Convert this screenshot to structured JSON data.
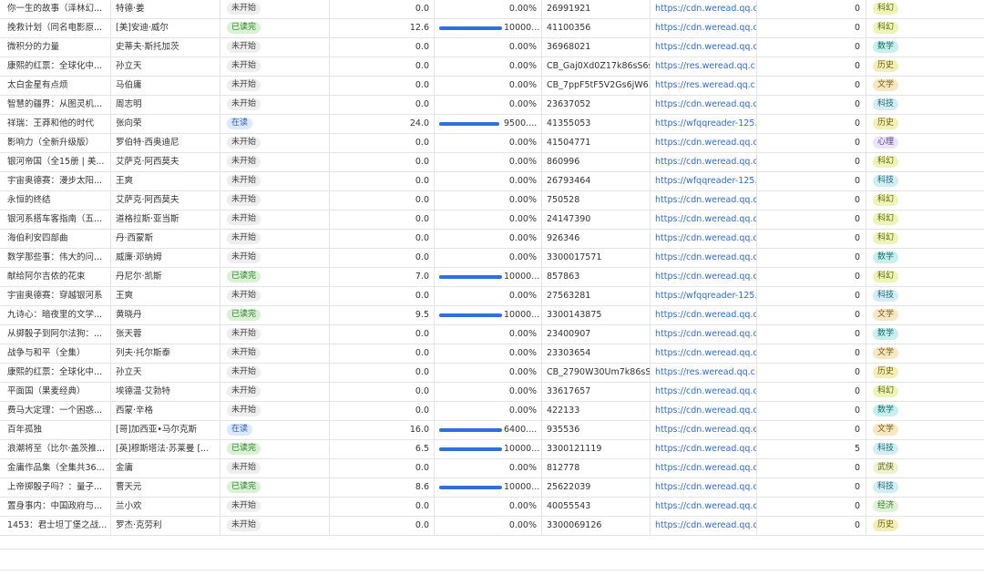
{
  "table": {
    "rows": [
      {
        "title": "你一生的故事（泽林幻...",
        "author": "特德·姜",
        "status": "未开始",
        "hours": "0.0",
        "progress": 0,
        "progress_text": "0.00%",
        "book_id": "26991921",
        "url": "https://cdn.weread.qq.c...",
        "notes": "0",
        "category": "科幻"
      },
      {
        "title": "挽救计划（同名电影原...",
        "author": "[美]安迪·威尔",
        "status": "已读完",
        "hours": "12.6",
        "progress": 1,
        "progress_text": "10000...",
        "book_id": "41100356",
        "url": "https://cdn.weread.qq.c...",
        "notes": "0",
        "category": "科幻"
      },
      {
        "title": "微积分的力量",
        "author": "史蒂夫·斯托加茨",
        "status": "未开始",
        "hours": "0.0",
        "progress": 0,
        "progress_text": "0.00%",
        "book_id": "36968021",
        "url": "https://cdn.weread.qq.c...",
        "notes": "0",
        "category": "数学"
      },
      {
        "title": "康熙的红票：全球化中...",
        "author": "孙立天",
        "status": "未开始",
        "hours": "0.0",
        "progress": 0,
        "progress_text": "0.00%",
        "book_id": "CB_Gaj0Xd0Z17k86sS6s...",
        "url": "https://res.weread.qq.c...",
        "notes": "0",
        "category": "历史"
      },
      {
        "title": "太白金星有点烦",
        "author": "马伯庸",
        "status": "未开始",
        "hours": "0.0",
        "progress": 0,
        "progress_text": "0.00%",
        "book_id": "CB_7ppF5tF5V2Gs6jW6...",
        "url": "https://res.weread.qq.c...",
        "notes": "0",
        "category": "文学"
      },
      {
        "title": "智慧的疆界：从图灵机...",
        "author": "周志明",
        "status": "未开始",
        "hours": "0.0",
        "progress": 0,
        "progress_text": "0.00%",
        "book_id": "23637052",
        "url": "https://cdn.weread.qq.c...",
        "notes": "0",
        "category": "科技"
      },
      {
        "title": "祥瑞：王莽和他的时代",
        "author": "张向荣",
        "status": "在读",
        "hours": "24.0",
        "progress": 0.95,
        "progress_text": "9500....",
        "book_id": "41355053",
        "url": "https://wfqqreader-125...",
        "notes": "0",
        "category": "历史"
      },
      {
        "title": "影响力（全新升级版）",
        "author": "罗伯特·西奥迪尼",
        "status": "未开始",
        "hours": "0.0",
        "progress": 0,
        "progress_text": "0.00%",
        "book_id": "41504771",
        "url": "https://cdn.weread.qq.c...",
        "notes": "0",
        "category": "心理"
      },
      {
        "title": "银河帝国（全15册 | 美...",
        "author": "艾萨克·阿西莫夫",
        "status": "未开始",
        "hours": "0.0",
        "progress": 0,
        "progress_text": "0.00%",
        "book_id": "860996",
        "url": "https://cdn.weread.qq.c...",
        "notes": "0",
        "category": "科幻"
      },
      {
        "title": "宇宙奥德赛：漫步太阳...",
        "author": "王爽",
        "status": "未开始",
        "hours": "0.0",
        "progress": 0,
        "progress_text": "0.00%",
        "book_id": "26793464",
        "url": "https://wfqqreader-125...",
        "notes": "0",
        "category": "科技"
      },
      {
        "title": "永恒的终结",
        "author": "艾萨克·阿西莫夫",
        "status": "未开始",
        "hours": "0.0",
        "progress": 0,
        "progress_text": "0.00%",
        "book_id": "750528",
        "url": "https://cdn.weread.qq.c...",
        "notes": "0",
        "category": "科幻"
      },
      {
        "title": "银河系搭车客指南（五...",
        "author": "道格拉斯·亚当斯",
        "status": "未开始",
        "hours": "0.0",
        "progress": 0,
        "progress_text": "0.00%",
        "book_id": "24147390",
        "url": "https://cdn.weread.qq.c...",
        "notes": "0",
        "category": "科幻"
      },
      {
        "title": "海伯利安四部曲",
        "author": "丹·西蒙斯",
        "status": "未开始",
        "hours": "0.0",
        "progress": 0,
        "progress_text": "0.00%",
        "book_id": "926346",
        "url": "https://cdn.weread.qq.c...",
        "notes": "0",
        "category": "科幻"
      },
      {
        "title": "数学那些事：伟大的问...",
        "author": "威廉·邓纳姆",
        "status": "未开始",
        "hours": "0.0",
        "progress": 0,
        "progress_text": "0.00%",
        "book_id": "3300017571",
        "url": "https://cdn.weread.qq.c...",
        "notes": "0",
        "category": "数学"
      },
      {
        "title": "献给阿尔吉侬的花束",
        "author": "丹尼尔·凯斯",
        "status": "已读完",
        "hours": "7.0",
        "progress": 1,
        "progress_text": "10000...",
        "book_id": "857863",
        "url": "https://cdn.weread.qq.c...",
        "notes": "0",
        "category": "科幻"
      },
      {
        "title": "宇宙奥德赛：穿越银河系",
        "author": "王爽",
        "status": "未开始",
        "hours": "0.0",
        "progress": 0,
        "progress_text": "0.00%",
        "book_id": "27563281",
        "url": "https://wfqqreader-125...",
        "notes": "0",
        "category": "科技"
      },
      {
        "title": "九诗心：暗夜里的文学...",
        "author": "黄晓丹",
        "status": "已读完",
        "hours": "9.5",
        "progress": 1,
        "progress_text": "10000...",
        "book_id": "3300143875",
        "url": "https://cdn.weread.qq.c...",
        "notes": "0",
        "category": "文学"
      },
      {
        "title": "从掷骰子到阿尔法狗：...",
        "author": "张天蓉",
        "status": "未开始",
        "hours": "0.0",
        "progress": 0,
        "progress_text": "0.00%",
        "book_id": "23400907",
        "url": "https://cdn.weread.qq.c...",
        "notes": "0",
        "category": "数学"
      },
      {
        "title": "战争与和平（全集）",
        "author": "列夫·托尔斯泰",
        "status": "未开始",
        "hours": "0.0",
        "progress": 0,
        "progress_text": "0.00%",
        "book_id": "23303654",
        "url": "https://cdn.weread.qq.c...",
        "notes": "0",
        "category": "文学"
      },
      {
        "title": "康熙的红票：全球化中...",
        "author": "孙立天",
        "status": "未开始",
        "hours": "0.0",
        "progress": 0,
        "progress_text": "0.00%",
        "book_id": "CB_2790W30Um7k86sS...",
        "url": "https://res.weread.qq.c...",
        "notes": "0",
        "category": "历史"
      },
      {
        "title": "平面国（果麦经典）",
        "author": "埃德温·艾勃特",
        "status": "未开始",
        "hours": "0.0",
        "progress": 0,
        "progress_text": "0.00%",
        "book_id": "33617657",
        "url": "https://cdn.weread.qq.c...",
        "notes": "0",
        "category": "科幻"
      },
      {
        "title": "费马大定理：一个困惑...",
        "author": "西蒙·辛格",
        "status": "未开始",
        "hours": "0.0",
        "progress": 0,
        "progress_text": "0.00%",
        "book_id": "422133",
        "url": "https://cdn.weread.qq.c...",
        "notes": "0",
        "category": "数学"
      },
      {
        "title": "百年孤独",
        "author": "[哥]加西亚•马尔克斯",
        "status": "在读",
        "hours": "16.0",
        "progress": 1,
        "progress_text": "6400....",
        "book_id": "935536",
        "url": "https://cdn.weread.qq.c...",
        "notes": "0",
        "category": "文学"
      },
      {
        "title": "浪潮将至（比尔·盖茨推...",
        "author": "[英]穆斯塔法·苏莱曼 [...",
        "status": "已读完",
        "hours": "6.5",
        "progress": 1,
        "progress_text": "10000...",
        "book_id": "3300121119",
        "url": "https://cdn.weread.qq.c...",
        "notes": "5",
        "category": "科技"
      },
      {
        "title": "金庸作品集（全集共36...",
        "author": "金庸",
        "status": "未开始",
        "hours": "0.0",
        "progress": 0,
        "progress_text": "0.00%",
        "book_id": "812778",
        "url": "https://cdn.weread.qq.c...",
        "notes": "0",
        "category": "武侠"
      },
      {
        "title": "上帝掷骰子吗？：量子...",
        "author": "曹天元",
        "status": "已读完",
        "hours": "8.6",
        "progress": 1,
        "progress_text": "10000...",
        "book_id": "25622039",
        "url": "https://cdn.weread.qq.c...",
        "notes": "0",
        "category": "科技"
      },
      {
        "title": "置身事内：中国政府与...",
        "author": "兰小欢",
        "status": "未开始",
        "hours": "0.0",
        "progress": 0,
        "progress_text": "0.00%",
        "book_id": "40055543",
        "url": "https://cdn.weread.qq.c...",
        "notes": "0",
        "category": "经济"
      },
      {
        "title": "1453：君士坦丁堡之战...",
        "author": "罗杰·克劳利",
        "status": "未开始",
        "hours": "0.0",
        "progress": 0,
        "progress_text": "0.00%",
        "book_id": "3300069126",
        "url": "https://cdn.weread.qq.c...",
        "notes": "0",
        "category": "历史"
      }
    ]
  },
  "colors": {
    "status": {
      "未开始": {
        "bg": "#eeeeee",
        "fg": "#444444"
      },
      "已读完": {
        "bg": "#d9f2d4",
        "fg": "#2d7a2d"
      },
      "在读": {
        "bg": "#dce8fb",
        "fg": "#2b5fb3"
      }
    },
    "category": {
      "科幻": {
        "bg": "#eef3b6",
        "fg": "#5a6612"
      },
      "数学": {
        "bg": "#c7efee",
        "fg": "#156c6a"
      },
      "历史": {
        "bg": "#f3efb6",
        "fg": "#6b6312"
      },
      "文学": {
        "bg": "#f7e7c2",
        "fg": "#7a5a16"
      },
      "科技": {
        "bg": "#d3eef3",
        "fg": "#1d6876"
      },
      "心理": {
        "bg": "#ebe3f7",
        "fg": "#5b3f8a"
      },
      "武侠": {
        "bg": "#f0f2cf",
        "fg": "#5f6616"
      },
      "经济": {
        "bg": "#dff2d6",
        "fg": "#3c7a28"
      }
    }
  }
}
